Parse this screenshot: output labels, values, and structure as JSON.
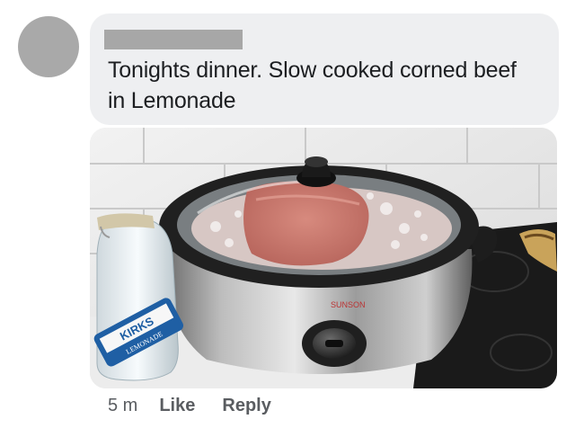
{
  "comment": {
    "text": "Tonights dinner. Slow cooked corned beef in Lemonade"
  },
  "photo": {
    "bottle_brand": "KIRKS",
    "bottle_flavor": "LEMONADE",
    "cooker_brand": "SUNSON"
  },
  "actions": {
    "time": "5 m",
    "like_label": "Like",
    "reply_label": "Reply"
  },
  "colors": {
    "bubble_bg": "#eeeff1",
    "avatar_placeholder": "#a9a9a9",
    "name_redaction": "#a7a7a7",
    "text": "#1c1e21",
    "meta_text": "#5a5d61"
  }
}
